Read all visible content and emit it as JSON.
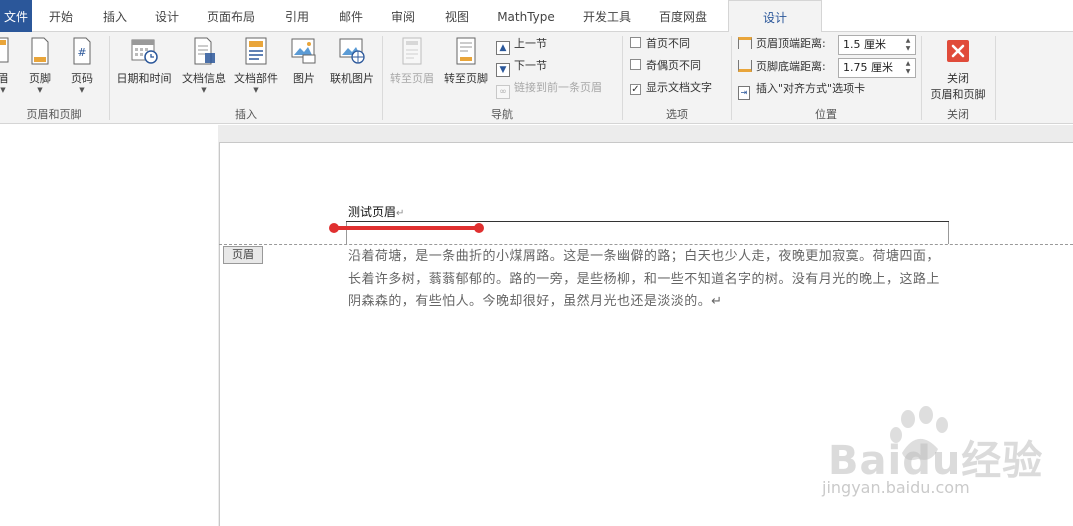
{
  "tabs": [
    {
      "label": "文件"
    },
    {
      "label": "开始"
    },
    {
      "label": "插入"
    },
    {
      "label": "设计"
    },
    {
      "label": "页面布局"
    },
    {
      "label": "引用"
    },
    {
      "label": "邮件"
    },
    {
      "label": "审阅"
    },
    {
      "label": "视图"
    },
    {
      "label": "MathType"
    },
    {
      "label": "开发工具"
    },
    {
      "label": "百度网盘"
    },
    {
      "label": "设计"
    }
  ],
  "ribbon": {
    "group_header_footer": {
      "label": "页眉和页脚",
      "header_btn": "眉",
      "footer_btn": "页脚",
      "pagenum_btn": "页码"
    },
    "group_insert": {
      "label": "插入",
      "datetime_btn": "日期和时间",
      "docinfo_btn": "文档信息",
      "docparts_btn": "文档部件",
      "picture_btn": "图片",
      "onlinepic_btn": "联机图片"
    },
    "group_nav": {
      "label": "导航",
      "goto_header_btn": "转至页眉",
      "goto_footer_btn": "转至页脚",
      "prev_btn": "上一节",
      "next_btn": "下一节",
      "link_prev_btn": "链接到前一条页眉"
    },
    "group_options": {
      "label": "选项",
      "diff_first": "首页不同",
      "diff_odd_even": "奇偶页不同",
      "show_doc_text": "显示文档文字",
      "show_doc_text_checked": "✓"
    },
    "group_position": {
      "label": "位置",
      "header_dist_label": "页眉顶端距离:",
      "header_dist_value": "1.5 厘米",
      "footer_dist_label": "页脚底端距离:",
      "footer_dist_value": "1.75 厘米",
      "insert_align_tab": "插入\"对齐方式\"选项卡"
    },
    "group_close": {
      "label": "关闭",
      "close_btn_line1": "关闭",
      "close_btn_line2": "页眉和页脚"
    }
  },
  "document": {
    "header_text": "测试页眉",
    "header_mark": "↵",
    "header_tag": "页眉",
    "body_text": "沿着荷塘，是一条曲折的小煤屑路。这是一条幽僻的路；白天也少人走，夜晚更加寂寞。荷塘四面，长着许多树，蓊蓊郁郁的。路的一旁，是些杨柳，和一些不知道名字的树。没有月光的晚上，这路上阴森森的，有些怕人。今晚却很好，虽然月光也还是淡淡的。↵"
  },
  "watermark": {
    "brand": "Baidu经验",
    "url": "jingyan.baidu.com"
  },
  "colors": {
    "file_tab": "#2b579a",
    "accent": "#2b579a",
    "annotation": "#e03030",
    "close_icon": "#e04b3a"
  }
}
